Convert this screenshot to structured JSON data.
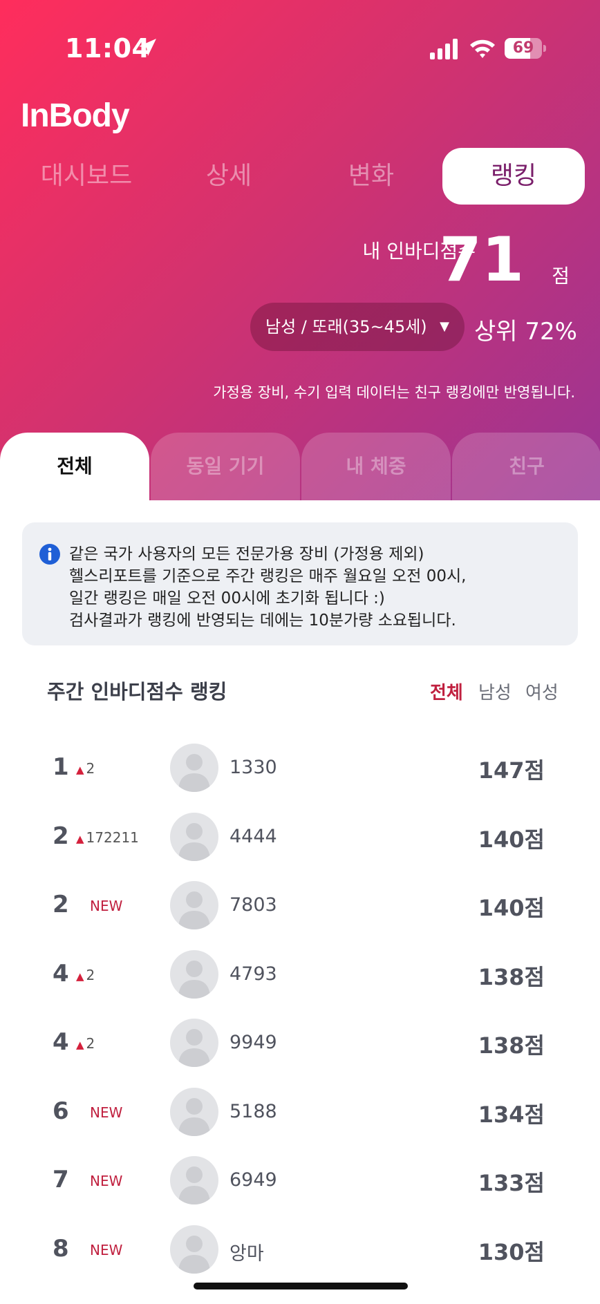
{
  "status_bar": {
    "time": "11:04",
    "battery": "69",
    "battery_level": 0.69
  },
  "app": {
    "logo": "InBody"
  },
  "top_nav": [
    {
      "label": "대시보드",
      "active": false
    },
    {
      "label": "상세",
      "active": false
    },
    {
      "label": "변화",
      "active": false
    },
    {
      "label": "랭킹",
      "active": true
    }
  ],
  "score": {
    "label": "내 인바디점수",
    "value": "71",
    "unit": "점"
  },
  "group_select": {
    "value": "남성 / 또래(35~45세)",
    "caret": "▼"
  },
  "percentile": "상위 72%",
  "notice": "가정용 장비, 수기 입력 데이터는 친구 랭킹에만 반영됩니다.",
  "tabs": [
    {
      "label": "전체",
      "active": true
    },
    {
      "label": "동일 기기",
      "active": false
    },
    {
      "label": "내 체중",
      "active": false
    },
    {
      "label": "친구",
      "active": false
    }
  ],
  "info_lines": [
    "같은 국가 사용자의 모든 전문가용 장비 (가정용 제외)",
    "헬스리포트를 기준으로 주간 랭킹은 매주 월요일 오전 00시,",
    "일간 랭킹은 매일 오전 00시에 초기화 됩니다 :)",
    "검사결과가 랭킹에 반영되는 데에는 10분가량 소요됩니다."
  ],
  "ranking": {
    "title": "주간 인바디점수 랭킹",
    "filters": [
      {
        "label": "전체",
        "active": true
      },
      {
        "label": "남성",
        "active": false
      },
      {
        "label": "여성",
        "active": false
      }
    ],
    "rows": [
      {
        "rank": "1",
        "change": "2",
        "is_new": false,
        "name": "1330",
        "score": "147점"
      },
      {
        "rank": "2",
        "change": "172211",
        "is_new": false,
        "name": "4444",
        "score": "140점"
      },
      {
        "rank": "2",
        "change": "NEW",
        "is_new": true,
        "name": "7803",
        "score": "140점"
      },
      {
        "rank": "4",
        "change": "2",
        "is_new": false,
        "name": "4793",
        "score": "138점"
      },
      {
        "rank": "4",
        "change": "2",
        "is_new": false,
        "name": "9949",
        "score": "138점"
      },
      {
        "rank": "6",
        "change": "NEW",
        "is_new": true,
        "name": "5188",
        "score": "134점"
      },
      {
        "rank": "7",
        "change": "NEW",
        "is_new": true,
        "name": "6949",
        "score": "133점"
      },
      {
        "rank": "8",
        "change": "NEW",
        "is_new": true,
        "name": "앙마",
        "score": "130점"
      }
    ]
  },
  "colors": {
    "accent": "#c0203f",
    "gradient_start": "#ff2d5c",
    "gradient_end": "#9a3494",
    "up_arrow": "#d4203c"
  }
}
